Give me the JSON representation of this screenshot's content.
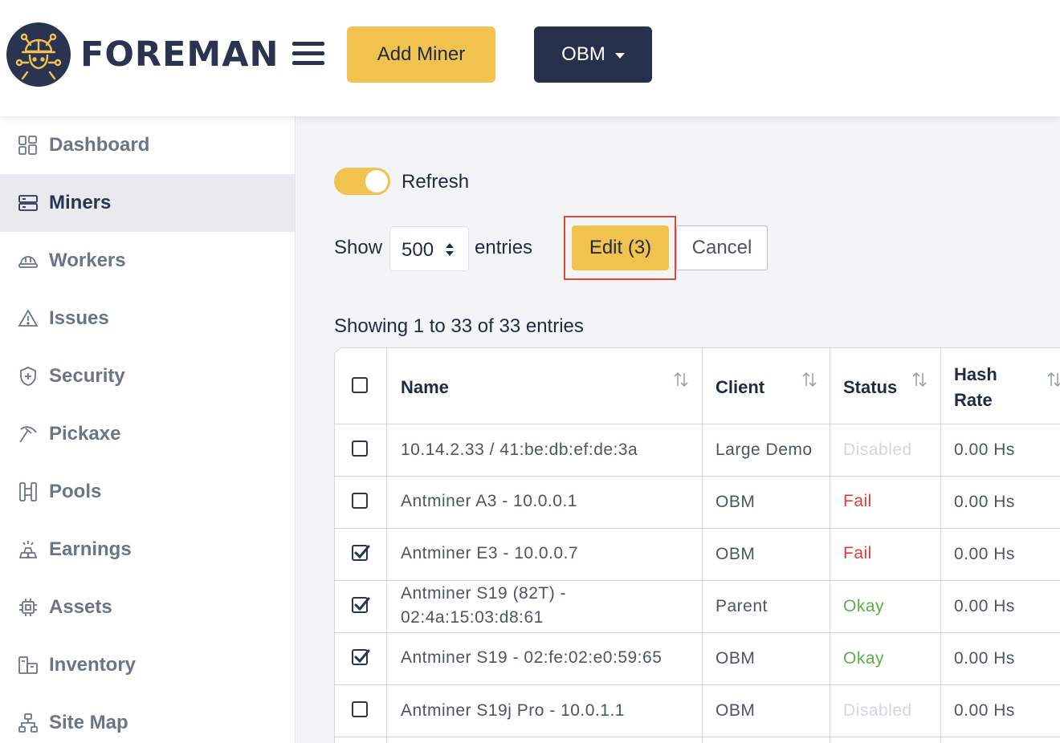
{
  "app": {
    "brand": "FOREMAN",
    "add_miner_label": "Add Miner",
    "client_selector": "OBM"
  },
  "sidebar": {
    "items": [
      {
        "label": "Dashboard",
        "icon": "dashboard-icon",
        "active": false
      },
      {
        "label": "Miners",
        "icon": "server-icon",
        "active": true
      },
      {
        "label": "Workers",
        "icon": "hardhat-icon",
        "active": false
      },
      {
        "label": "Issues",
        "icon": "warning-icon",
        "active": false
      },
      {
        "label": "Security",
        "icon": "shield-icon",
        "active": false
      },
      {
        "label": "Pickaxe",
        "icon": "pickaxe-icon",
        "active": false
      },
      {
        "label": "Pools",
        "icon": "pools-icon",
        "active": false
      },
      {
        "label": "Earnings",
        "icon": "gold-bars-icon",
        "active": false
      },
      {
        "label": "Assets",
        "icon": "chip-icon",
        "active": false
      },
      {
        "label": "Inventory",
        "icon": "boxes-icon",
        "active": false
      },
      {
        "label": "Site Map",
        "icon": "sitemap-icon",
        "active": false
      }
    ]
  },
  "main": {
    "refresh_label": "Refresh",
    "refresh_on": true,
    "show_label": "Show",
    "page_size": "500",
    "entries_label": "entries",
    "edit_label": "Edit (3)",
    "cancel_label": "Cancel",
    "showing_text": "Showing 1 to 33 of 33 entries"
  },
  "table": {
    "headers": {
      "name": "Name",
      "client": "Client",
      "status": "Status",
      "hash_rate_line1": "Hash",
      "hash_rate_line2": "Rate"
    },
    "rows": [
      {
        "checked": false,
        "name_line1": "10.14.2.33 / 41:be:db:ef:de:3a",
        "name_line2": "",
        "client": "Large Demo",
        "status": "Disabled",
        "hash_rate": "0.00 Hs"
      },
      {
        "checked": false,
        "name_line1": "Antminer A3 - 10.0.0.1",
        "name_line2": "",
        "client": "OBM",
        "status": "Fail",
        "hash_rate": "0.00 Hs"
      },
      {
        "checked": true,
        "name_line1": "Antminer E3 - 10.0.0.7",
        "name_line2": "",
        "client": "OBM",
        "status": "Fail",
        "hash_rate": "0.00 Hs"
      },
      {
        "checked": true,
        "name_line1": "Antminer S19 (82T) -",
        "name_line2": "02:4a:15:03:d8:61",
        "client": "Parent",
        "status": "Okay",
        "hash_rate": "0.00 Hs"
      },
      {
        "checked": true,
        "name_line1": "Antminer S19 - 02:fe:02:e0:59:65",
        "name_line2": "",
        "client": "OBM",
        "status": "Okay",
        "hash_rate": "0.00 Hs"
      },
      {
        "checked": false,
        "name_line1": "Antminer S19j Pro - 10.0.1.1",
        "name_line2": "",
        "client": "OBM",
        "status": "Disabled",
        "hash_rate": "0.00 Hs"
      }
    ]
  },
  "colors": {
    "accent": "#f2c24e",
    "navy": "#26304a",
    "status_fail": "#e53935",
    "status_okay": "#5bb045",
    "status_disabled": "#d3d6dc",
    "highlight_outline": "#e0483a"
  }
}
